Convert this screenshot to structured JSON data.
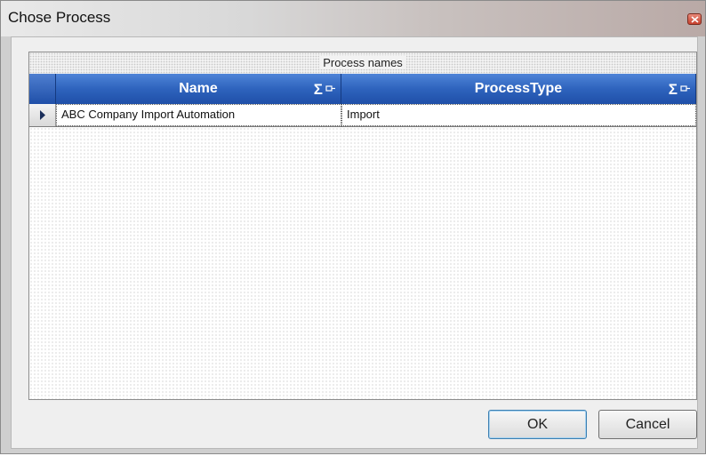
{
  "window": {
    "title": "Chose Process"
  },
  "grid": {
    "group_caption": "Process names",
    "columns": [
      {
        "label": "Name",
        "sigma": "Σ"
      },
      {
        "label": "ProcessType",
        "sigma": "Σ"
      }
    ],
    "rows": [
      {
        "name": "ABC Company Import Automation",
        "process_type": "Import"
      }
    ]
  },
  "buttons": {
    "ok_label": "OK",
    "cancel_label": "Cancel"
  },
  "colors": {
    "header_blue": "#2e63bd",
    "close_red": "#c8412e"
  }
}
